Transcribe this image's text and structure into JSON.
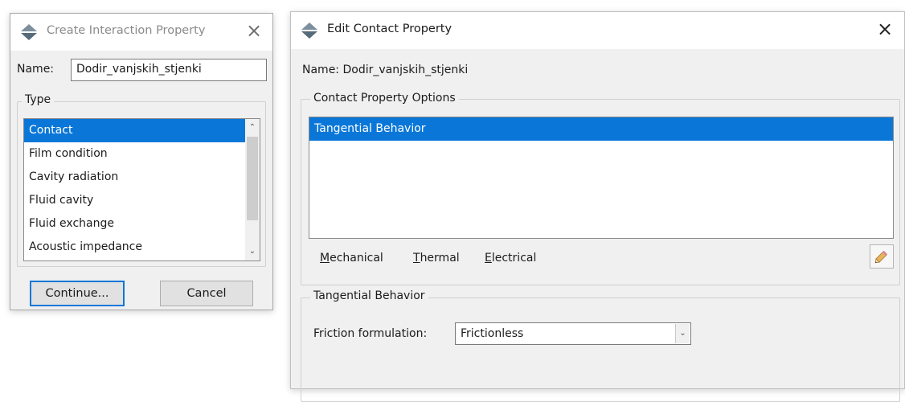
{
  "create_dialog": {
    "title": "Create Interaction Property",
    "name_label": "Name:",
    "name_value": "Dodir_vanjskih_stjenki",
    "type_group_title": "Type",
    "type_items": [
      {
        "label": "Contact",
        "selected": true
      },
      {
        "label": "Film condition",
        "selected": false
      },
      {
        "label": "Cavity radiation",
        "selected": false
      },
      {
        "label": "Fluid cavity",
        "selected": false
      },
      {
        "label": "Fluid exchange",
        "selected": false
      },
      {
        "label": "Acoustic impedance",
        "selected": false
      }
    ],
    "continue_label": "Continue...",
    "cancel_label": "Cancel"
  },
  "edit_dialog": {
    "title": "Edit Contact Property",
    "name_text": "Name:  Dodir_vanjskih_stjenki",
    "options_group_title": "Contact Property Options",
    "options_items": [
      {
        "label": "Tangential Behavior",
        "selected": true
      }
    ],
    "menu_tabs": [
      {
        "first": "M",
        "rest": "echanical"
      },
      {
        "first": "T",
        "rest": "hermal"
      },
      {
        "first": "E",
        "rest": "lectrical"
      }
    ],
    "behavior_group_title": "Tangential Behavior",
    "friction_label": "Friction formulation:",
    "friction_value": "Frictionless"
  },
  "icons": {
    "app": "abaqus-diamond-icon",
    "close": "close-icon",
    "edit": "pencil-icon"
  },
  "colors": {
    "selection": "#0a77d8",
    "dialog_bg": "#f0f0f0"
  }
}
